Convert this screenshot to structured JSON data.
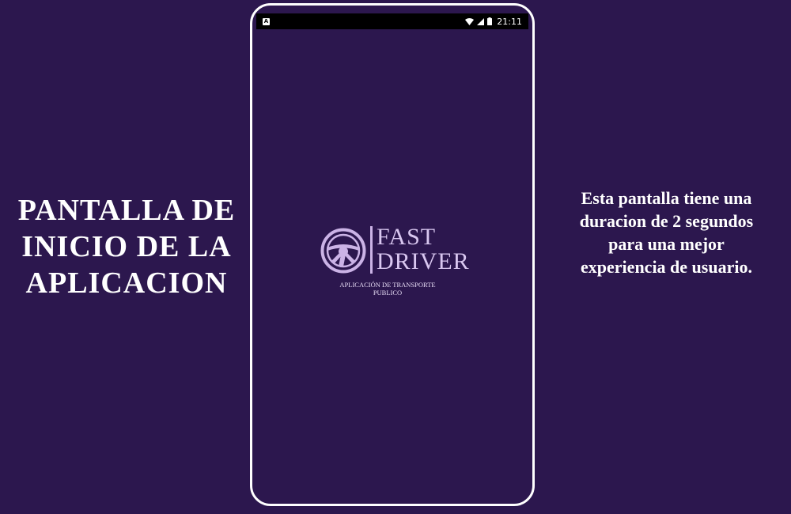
{
  "left_title": {
    "lines": [
      "PANTALLA DE",
      "INICIO DE LA",
      "APLICACION"
    ]
  },
  "right_description": {
    "lines": [
      "Esta pantalla tiene una",
      "duracion de 2 segundos",
      "para una mejor",
      "experiencia de usuario."
    ]
  },
  "phone": {
    "status_bar": {
      "left_icon": "android-notification-icon",
      "time": "21:11",
      "icons": [
        "wifi-icon",
        "signal-icon",
        "battery-icon"
      ]
    },
    "logo": {
      "icon": "steering-wheel-icon",
      "brand_line_1": "FAST",
      "brand_line_2": "DRIVER",
      "tagline_1": "APLICACIÓN DE TRANSPORTE",
      "tagline_2": "PUBLICO"
    }
  },
  "colors": {
    "background": "#2c174e",
    "text": "#ffffff",
    "logo_text": "#d9c7f0"
  }
}
